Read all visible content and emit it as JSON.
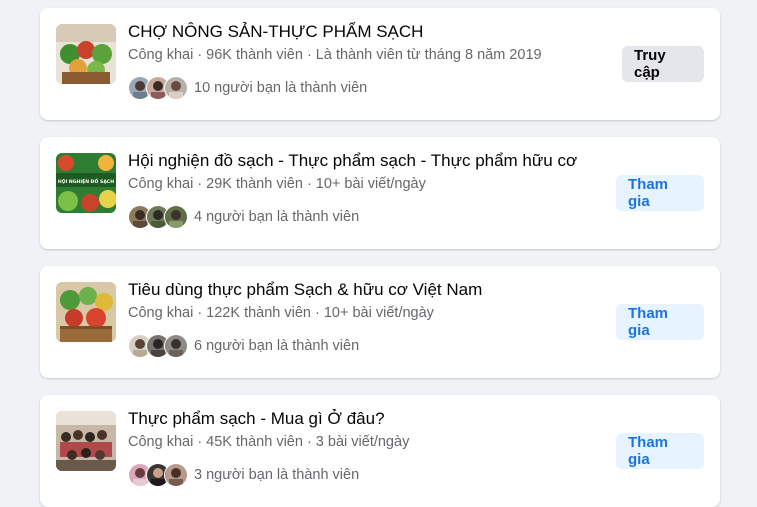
{
  "colors": {
    "page_background": "#f0f2f5",
    "card_background": "#ffffff",
    "title_text": "#050505",
    "secondary_text": "#65676b",
    "visit_button_bg": "#e4e6eb",
    "join_button_bg": "#e7f3ff",
    "join_button_text": "#1b74e4"
  },
  "groups": [
    {
      "name": "CHỢ NÔNG SẢN-THỰC PHẨM SẠCH",
      "meta": "Công khai · 96K thành viên · Là thành viên từ tháng 8 năm 2019",
      "friends_text": "10 người bạn là thành viên",
      "button": "Truy cập"
    },
    {
      "name": "Hội nghiện đồ sạch - Thực phẩm sạch - Thực phẩm hữu cơ",
      "meta": "Công khai · 29K thành viên · 10+ bài viết/ngày",
      "friends_text": "4 người bạn là thành viên",
      "button": "Tham gia",
      "thumb_text": "HỘI NGHIỆN ĐỒ SẠCH"
    },
    {
      "name": "Tiêu dùng thực phẩm Sạch & hữu cơ Việt Nam",
      "meta": "Công khai · 122K thành viên · 10+ bài viết/ngày",
      "friends_text": "6 người bạn là thành viên",
      "button": "Tham gia"
    },
    {
      "name": "Thực phẩm sạch - Mua gì Ở đâu?",
      "meta": "Công khai · 45K thành viên · 3 bài viết/ngày",
      "friends_text": "3 người bạn là thành viên",
      "button": "Tham gia"
    }
  ]
}
